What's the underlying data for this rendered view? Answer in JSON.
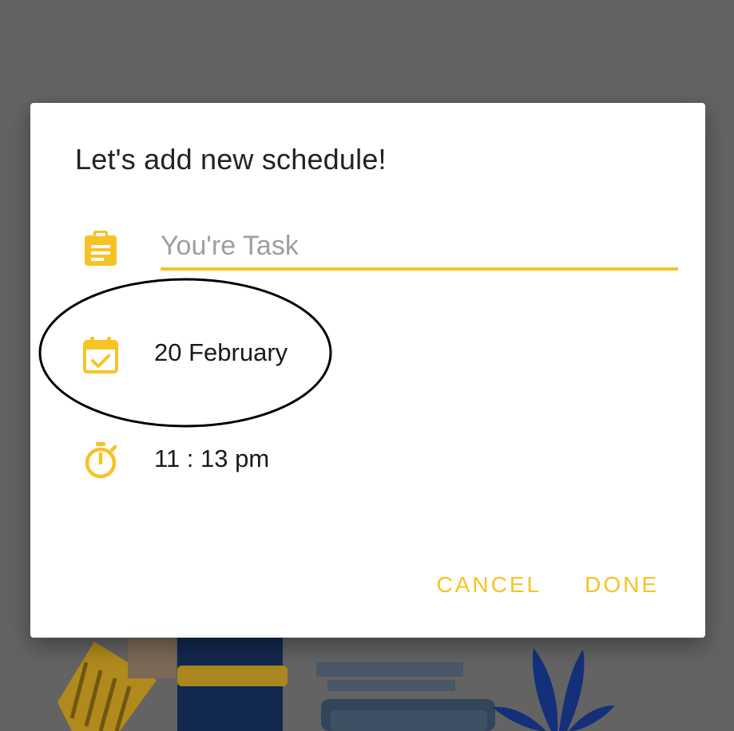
{
  "dialog": {
    "title": "Let's add new schedule!",
    "task_input": {
      "value": "",
      "placeholder": "You're Task",
      "icon": "clipboard-icon"
    },
    "date_row": {
      "value": "20 February",
      "icon": "calendar-check-icon"
    },
    "time_row": {
      "value": "11 : 13 pm",
      "icon": "stopwatch-icon"
    },
    "actions": {
      "cancel_label": "CANCEL",
      "done_label": "DONE"
    }
  },
  "theme": {
    "accent": "#F6C324",
    "scrim": "#636363",
    "surface": "#FFFFFF",
    "text": "#222222",
    "placeholder": "#9E9E9E",
    "annotation": "#000000"
  }
}
